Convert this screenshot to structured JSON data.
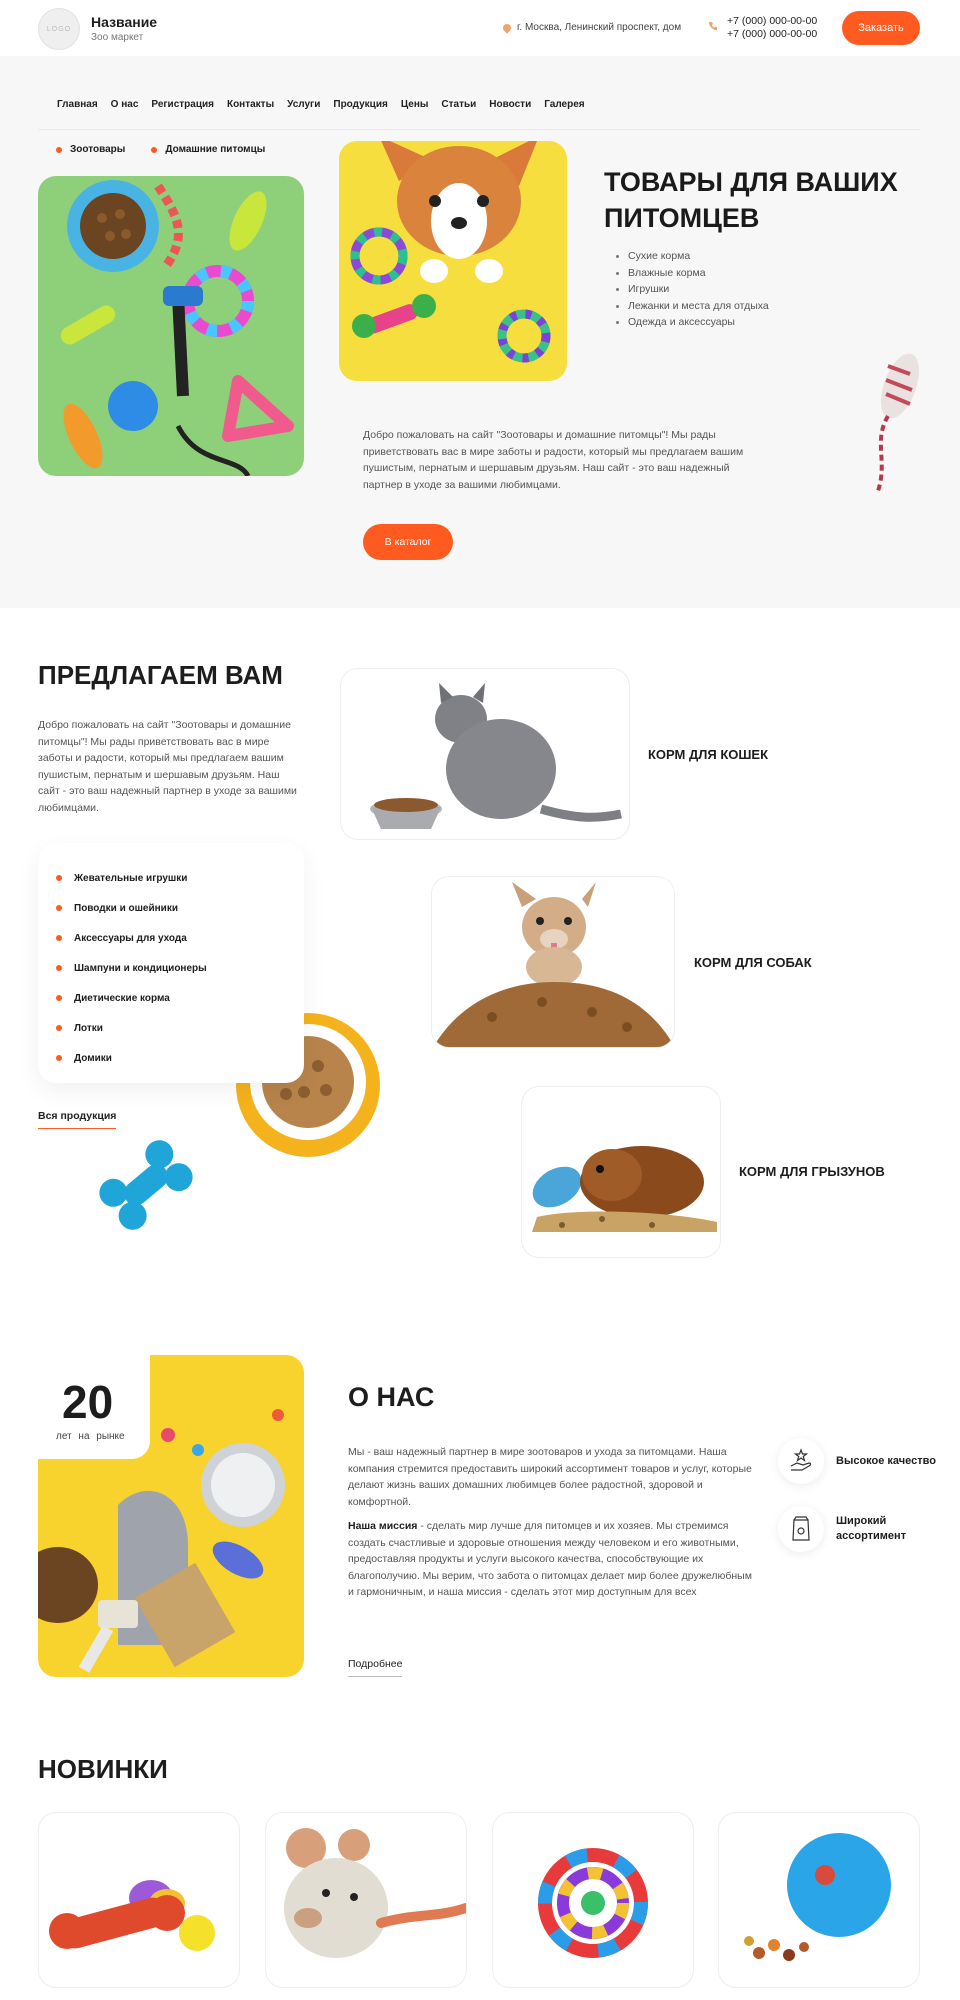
{
  "header": {
    "logo_text": "LOGO",
    "brand_name": "Название",
    "brand_sub": "Зоо маркет",
    "address": "г. Москва, Ленинский проспект, дом",
    "phones": [
      "+7 (000) 000-00-00",
      "+7 (000) 000-00-00"
    ],
    "order_label": "Заказать"
  },
  "nav": [
    "Главная",
    "О нас",
    "Регистрация",
    "Контакты",
    "Услуги",
    "Продукция",
    "Цены",
    "Статьи",
    "Новости",
    "Галерея"
  ],
  "hero": {
    "tags": [
      "Зоотовары",
      "Домашние питомцы"
    ],
    "title_line1": "ТОВАРЫ ДЛЯ ВАШИХ",
    "title_line2": "ПИТОМЦЕВ",
    "list": [
      "Сухие корма",
      "Влажные корма",
      "Игрушки",
      "Лежанки и места для отдыха",
      "Одежда и аксессуары"
    ],
    "text": "Добро пожаловать на сайт \"Зоотовары и домашние питомцы\"! Мы рады приветствовать вас в мире заботы и радости, который мы предлагаем вашим пушистым, пернатым и шершавым друзьям. Наш сайт - это ваш надежный партнер в уходе за вашими любимцами.",
    "button": "В каталог"
  },
  "offer": {
    "title": "ПРЕДЛАГАЕМ ВАМ",
    "text": "Добро пожаловать на сайт \"Зоотовары и домашние питомцы\"! Мы рады приветствовать вас в мире заботы и радости, который мы предлагаем вашим пушистым, пернатым и шершавым друзьям. Наш сайт - это ваш надежный партнер в уходе за вашими любимцами.",
    "list": [
      "Жевательные игрушки",
      "Поводки и ошейники",
      "Аксессуары для ухода",
      "Шампуни и кондиционеры",
      "Диетические корма",
      "Лотки",
      "Домики"
    ],
    "all_link": "Вся продукция",
    "cards": [
      "КОРМ ДЛЯ КОШЕК",
      "КОРМ ДЛЯ СОБАК",
      "КОРМ ДЛЯ ГРЫЗУНОВ"
    ]
  },
  "about": {
    "years": "20",
    "years_caption": "лет на рынке",
    "title": "О НАС",
    "p1": "Мы - ваш надежный партнер в мире зоотоваров и ухода за питомцами. Наша компания стремится предоставить широкий ассортимент товаров и услуг, которые делают жизнь ваших домашних любимцев более радостной, здоровой и комфортной.",
    "mission_label": "Наша миссия",
    "mission_text": " - сделать мир лучше для питомцев и их хозяев. Мы стремимся создать счастливые и здоровые отношения между человеком и его животными, предоставляя продукты и услуги высокого качества, способствующие их благополучию. Мы верим, что забота о питомцах делает мир более дружелюбным и гармоничным, и наша миссия - сделать этот мир доступным для всех",
    "more": "Подробнее",
    "features": [
      "Высокое качество",
      "Широкий ассортимент"
    ]
  },
  "news": {
    "title": "НОВИНКИ"
  },
  "colors": {
    "accent": "#ff5a1f",
    "hero_bg": "#f7f7f7"
  }
}
